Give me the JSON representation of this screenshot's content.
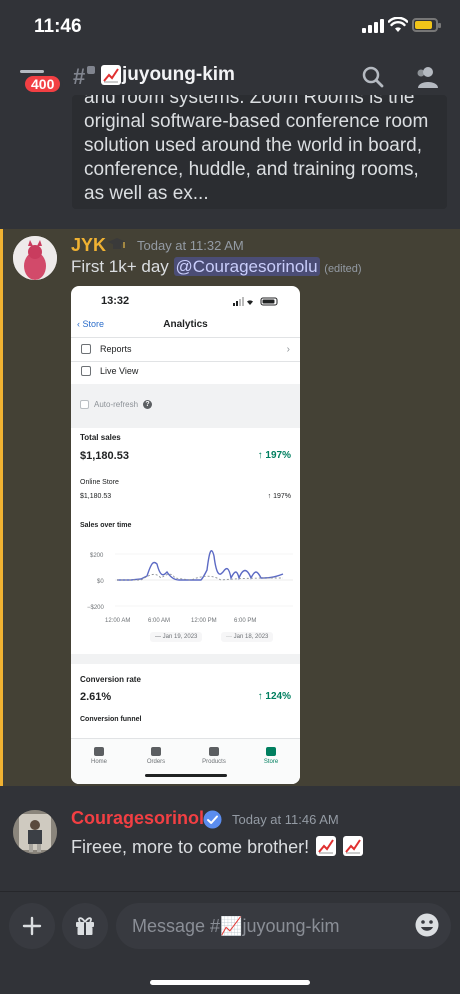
{
  "status_bar": {
    "time": "11:46"
  },
  "header": {
    "notification_count": "400",
    "channel_name": "juyoung-kim"
  },
  "embed": {
    "text": "and room systems. Zoom Rooms is the original software-based conference room solution used around the world in board, conference, huddle, and training rooms, as well as ex..."
  },
  "message1": {
    "author": "JYK",
    "timestamp": "Today at 11:32 AM",
    "text": "First 1k+ day",
    "mention": "@Couragesorinolu",
    "edited": "(edited)",
    "screenshot": {
      "time": "13:32",
      "back_label": "Store",
      "title": "Analytics",
      "rows": [
        "Reports",
        "Live View"
      ],
      "auto_refresh": "Auto-refresh",
      "total_sales_label": "Total sales",
      "total_sales_value": "$1,180.53",
      "total_sales_change": "197%",
      "online_store_label": "Online Store",
      "online_store_value": "$1,180.53",
      "online_store_change": "197%",
      "sales_over_time_label": "Sales over time",
      "y_ticks": [
        "$200",
        "$0",
        "−$200"
      ],
      "x_ticks": [
        "12:00 AM",
        "6:00 AM",
        "12:00 PM",
        "6:00 PM"
      ],
      "legend": [
        "Jan 19, 2023",
        "Jan 18, 2023"
      ],
      "conversion_label": "Conversion rate",
      "conversion_value": "2.61%",
      "conversion_change": "124%",
      "funnel_label": "Conversion funnel",
      "tabs": [
        "Home",
        "Orders",
        "Products",
        "Store"
      ]
    }
  },
  "message2": {
    "author": "Couragesorinolu",
    "timestamp": "Today at 11:46 AM",
    "text": "Fireee, more to come brother!"
  },
  "composer": {
    "placeholder": "Message #📈juyoung-kim"
  },
  "colors": {
    "background": "#313338",
    "highlight": "#444135",
    "highlight_bar": "#f0b232",
    "author1": "#f0b232",
    "author2": "#f23f43",
    "badge": "#f23f43",
    "green": "#007f5f"
  }
}
